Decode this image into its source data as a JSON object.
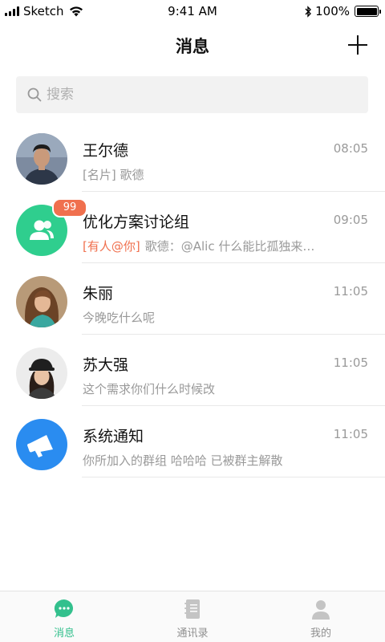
{
  "status_bar": {
    "carrier": "Sketch",
    "time": "9:41 AM",
    "battery": "100%"
  },
  "nav": {
    "title": "消息"
  },
  "search": {
    "placeholder": "搜索"
  },
  "conversations": [
    {
      "name": "王尔德",
      "time": "08:05",
      "preview": "[名片] 歌德",
      "mention": "",
      "avatar": "photo-man"
    },
    {
      "name": "优化方案讨论组",
      "time": "09:05",
      "preview": "歌德：@Alic 什么能比孤独来…",
      "mention": "[有人@你]",
      "badge": "99",
      "avatar": "group-icon",
      "avatar_color": "#2fce8e"
    },
    {
      "name": "朱丽",
      "time": "11:05",
      "preview": "今晚吃什么呢",
      "mention": "",
      "avatar": "photo-woman"
    },
    {
      "name": "苏大强",
      "time": "11:05",
      "preview": "这个需求你们什么时候改",
      "mention": "",
      "avatar": "photo-woman-cap"
    },
    {
      "name": "系统通知",
      "time": "11:05",
      "preview": "你所加入的群组 哈哈哈 已被群主解散",
      "mention": "",
      "avatar": "megaphone-icon",
      "avatar_color": "#2a8cf0"
    }
  ],
  "tabs": [
    {
      "label": "消息",
      "icon": "chat-bubble-icon",
      "active": true
    },
    {
      "label": "通讯录",
      "icon": "contacts-book-icon",
      "active": false
    },
    {
      "label": "我的",
      "icon": "person-icon",
      "active": false
    }
  ],
  "colors": {
    "accent": "#33c08d",
    "mention": "#f0704e",
    "badge": "#f0704e",
    "notify_blue": "#2a8cf0"
  }
}
